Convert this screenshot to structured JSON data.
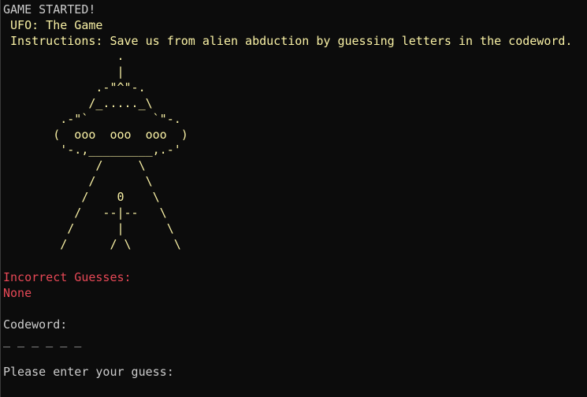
{
  "header": {
    "status": "GAME STARTED!",
    "title": " UFO: The Game",
    "instructions": " Instructions: Save us from alien abduction by guessing letters in the codeword."
  },
  "ufo_art": "                .\n                |\n             .-\"^\"-.\n            /_....._\\\n        .-\"`         `\"-.\n       (  ooo  ooo  ooo  )\n        '-.,_________,.-'\n             /     \\\n            /       \\\n           /    0    \\\n          /   --|--   \\\n         /      |      \\\n        /      / \\      \\",
  "incorrect": {
    "label": "Incorrect Guesses:",
    "value": "None"
  },
  "codeword": {
    "label": "Codeword:",
    "value": "_ _ _ _ _ _"
  },
  "prompt": "Please enter your guess:",
  "colors": {
    "background": "#0c0c0c",
    "text": "#cccccc",
    "ufo": "#f9f1a5",
    "error": "#e74856"
  }
}
